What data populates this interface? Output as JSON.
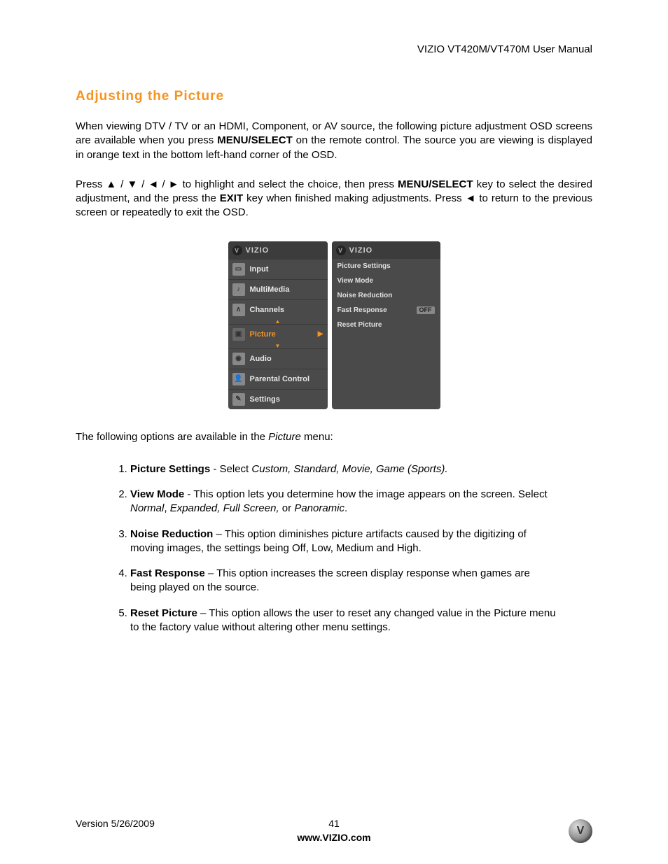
{
  "header": {
    "doc_title": "VIZIO VT420M/VT470M User Manual"
  },
  "section": {
    "title": "Adjusting the Picture"
  },
  "paras": {
    "p1a": "When viewing DTV / TV or an HDMI, Component, or AV source, the following picture adjustment OSD screens are available when you press ",
    "p1b": "MENU/SELECT",
    "p1c": " on the remote control. The source you are viewing is displayed in orange text in the bottom left-hand corner of the OSD.",
    "p2a": "Press ▲ / ▼ / ◄ / ► to highlight and select the choice, then press ",
    "p2b": "MENU/SELECT",
    "p2c": " key to select the desired adjustment, and the press the ",
    "p2d": "EXIT",
    "p2e": " key when finished making adjustments. Press ◄ to return to the previous screen or repeatedly to exit the OSD.",
    "p3a": "The following options are available in the ",
    "p3b": "Picture",
    "p3c": " menu:"
  },
  "osd": {
    "brand": "VIZIO",
    "left_items": [
      {
        "label": "Input",
        "selected": false
      },
      {
        "label": "MultiMedia",
        "selected": false
      },
      {
        "label": "Channels",
        "selected": false
      },
      {
        "label": "Picture",
        "selected": true
      },
      {
        "label": "Audio",
        "selected": false
      },
      {
        "label": "Parental Control",
        "selected": false
      },
      {
        "label": "Settings",
        "selected": false
      }
    ],
    "right_items": [
      {
        "label": "Picture Settings",
        "value": ""
      },
      {
        "label": "View Mode",
        "value": ""
      },
      {
        "label": "Noise Reduction",
        "value": ""
      },
      {
        "label": "Fast Response",
        "value": "OFF"
      },
      {
        "label": "Reset Picture",
        "value": ""
      }
    ]
  },
  "options": {
    "o1": {
      "t": "Picture Settings",
      "a": " - Select ",
      "i": "Custom, Standard, Movie, Game (Sports)."
    },
    "o2": {
      "t": "View Mode",
      "a": " - This ",
      "b": "option lets you determine how the image appears on the screen. Select ",
      "i": "Normal",
      "c": ", ",
      "i2": "Expanded, Full Screen,",
      "d": " or ",
      "i3": "Panoramic",
      "e": "."
    },
    "o3": {
      "t": "Noise Reduction",
      "a": " – This option ",
      "b": "diminishes picture artifacts caused by the digitizing of moving images, the settings being Off, Low, Medium and High."
    },
    "o4": {
      "t": "Fast Response",
      "a": " – This option increases the screen display response when games are being played on the source."
    },
    "o5": {
      "t": "Reset Picture",
      "a": " – This option allows the user to reset any changed value in the Picture menu to the factory value without altering other menu settings."
    }
  },
  "footer": {
    "version": "Version 5/26/2009",
    "page": "41",
    "url": "www.VIZIO.com"
  }
}
